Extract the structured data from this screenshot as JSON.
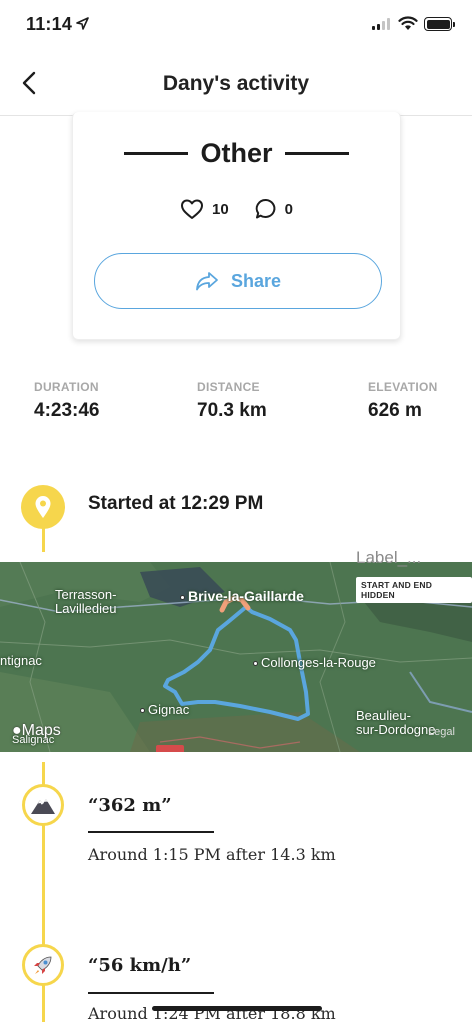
{
  "status_bar": {
    "time": "11:14"
  },
  "header": {
    "title": "Dany's activity"
  },
  "card": {
    "title": "Other",
    "likes": "10",
    "comments": "0",
    "share_label": "Share"
  },
  "stats": [
    {
      "label": "DURATION",
      "value": "4:23:46"
    },
    {
      "label": "DISTANCE",
      "value": "70.3 km"
    },
    {
      "label": "ELEVATION",
      "value": "626 m"
    }
  ],
  "timeline": {
    "start_text": "Started at 12:29 PM",
    "milestones": [
      {
        "title": "“362 m”",
        "subtitle": "Around 1:15 PM after 14.3 km",
        "icon": "mountain-icon"
      },
      {
        "title": "“56 km/h”",
        "subtitle": "Around 1:24 PM after 18.8 km",
        "icon": "rocket-icon"
      }
    ]
  },
  "map": {
    "overlay_label": "Label_...",
    "badge": "START AND END HIDDEN",
    "attribution": "Maps",
    "legal": "Legal",
    "places": [
      {
        "name": "Terrasson-\nLavilledieu"
      },
      {
        "name": "Brive-la-Gaillarde"
      },
      {
        "name": "Collonges-la-Rouge"
      },
      {
        "name": "ntignac"
      },
      {
        "name": "Gignac"
      },
      {
        "name": "Beaulieu-\nsur-Dordogne"
      },
      {
        "name": "Salignac"
      }
    ],
    "route_color": "#5aa6de",
    "hidden_segment_color": "#f2a07a"
  },
  "colors": {
    "accent": "#5aa6de",
    "timeline": "#f6d64c"
  }
}
